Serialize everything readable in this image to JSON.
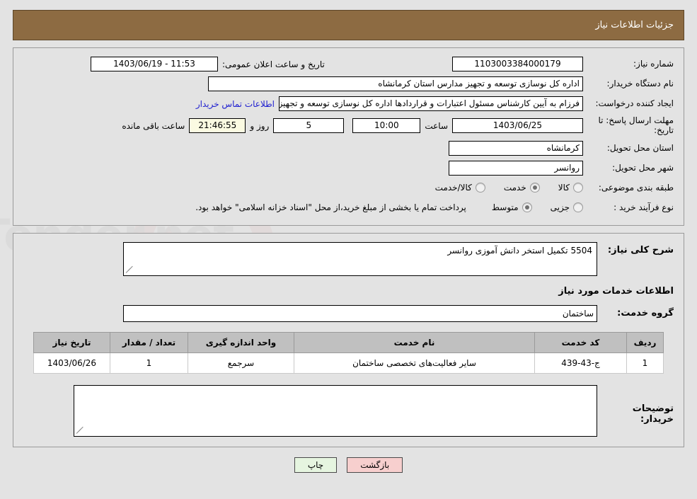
{
  "header": {
    "title": "جزئیات اطلاعات نیاز"
  },
  "top": {
    "need_number": {
      "label": "شماره نیاز:",
      "value": "1103003384000179"
    },
    "public_announce": {
      "label": "تاریخ و ساعت اعلان عمومی:",
      "value": "11:53 - 1403/06/19"
    },
    "buyer_org": {
      "label": "نام دستگاه خریدار:",
      "value": "اداره کل نوسازی  توسعه و تجهیز مدارس استان کرمانشاه"
    },
    "requester": {
      "label": "ایجاد کننده درخواست:",
      "value": "فرزام به آیین کارشناس مسئول اعتبارات و قراردادها اداره کل نوسازی  توسعه و تجهیز",
      "contact_link": "اطلاعات تماس خریدار"
    },
    "deadline": {
      "label": "مهلت ارسال پاسخ: تا تاریخ:",
      "date": "1403/06/25",
      "hour_label": "ساعت",
      "hour": "10:00",
      "days": "5",
      "days_sep": "روز و",
      "countdown": "21:46:55",
      "remaining_label": "ساعت باقی مانده"
    },
    "province": {
      "label": "استان محل تحویل:",
      "value": "کرمانشاه"
    },
    "city": {
      "label": "شهر محل تحویل:",
      "value": "روانسر"
    },
    "category": {
      "label": "طبقه بندی موضوعی:",
      "options": [
        {
          "label": "کالا",
          "selected": false
        },
        {
          "label": "خدمت",
          "selected": true
        },
        {
          "label": "کالا/خدمت",
          "selected": false
        }
      ]
    },
    "purchase_type": {
      "label": "نوع فرآیند خرید :",
      "options": [
        {
          "label": "جزیی",
          "selected": false
        },
        {
          "label": "متوسط",
          "selected": true
        }
      ],
      "note": "پرداخت تمام یا بخشی از مبلغ خرید،از محل \"اسناد خزانه اسلامی\" خواهد بود."
    }
  },
  "middle": {
    "summary": {
      "label": "شرح کلی نیاز:",
      "value": "5504 تکمیل استخر دانش آموزی روانسر"
    },
    "services_section_title": "اطلاعات خدمات مورد نیاز",
    "service_group": {
      "label": "گروه خدمت:",
      "value": "ساختمان"
    },
    "table": {
      "columns": [
        "ردیف",
        "کد خدمت",
        "نام خدمت",
        "واحد اندازه گیری",
        "تعداد / مقدار",
        "تاریخ نیاز"
      ],
      "rows": [
        [
          "1",
          "ج-43-439",
          "سایر فعالیت‌های تخصصی ساختمان",
          "سرجمع",
          "1",
          "1403/06/26"
        ]
      ]
    },
    "buyer_notes": {
      "label": "توضیحات خریدار:",
      "value": ""
    }
  },
  "footer": {
    "back_button": "بازگشت",
    "print_button": "چاپ"
  },
  "colors": {
    "header_bg": "#8d6b42",
    "page_bg": "#e3e3e3",
    "link": "#2020d0",
    "back_btn": "#f7cfce",
    "print_btn": "#e6f5e0",
    "countdown_bg": "#fbfae2",
    "table_header_bg": "#c0c0c0"
  }
}
